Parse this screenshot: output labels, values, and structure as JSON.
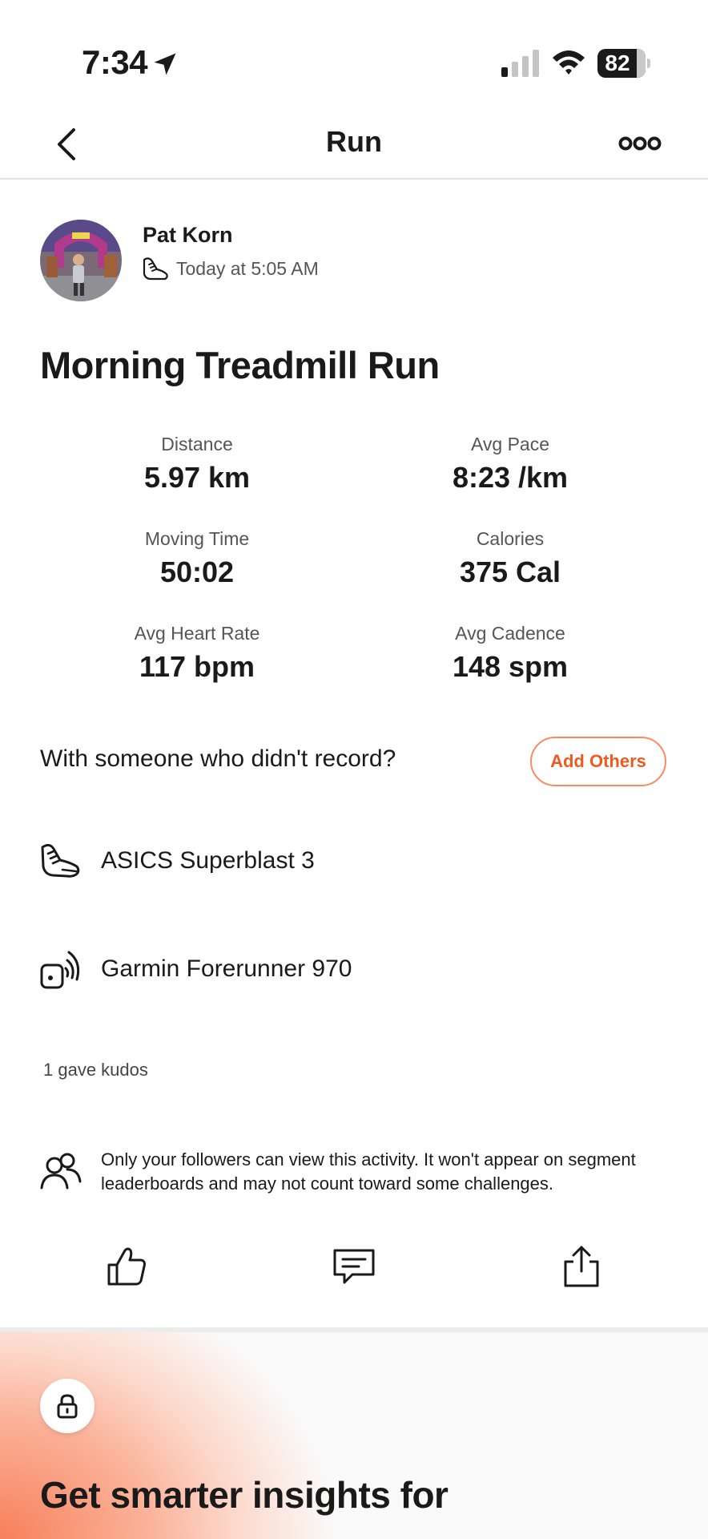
{
  "status_bar": {
    "time": "7:34",
    "battery": "82"
  },
  "nav": {
    "title": "Run"
  },
  "athlete": {
    "name": "Pat Korn",
    "time": "Today at 5:05 AM"
  },
  "activity": {
    "title": "Morning Treadmill Run"
  },
  "stats": [
    {
      "label": "Distance",
      "value": "5.97 km"
    },
    {
      "label": "Avg Pace",
      "value": "8:23 /km"
    },
    {
      "label": "Moving Time",
      "value": "50:02"
    },
    {
      "label": "Calories",
      "value": "375 Cal"
    },
    {
      "label": "Avg Heart Rate",
      "value": "117 bpm"
    },
    {
      "label": "Avg Cadence",
      "value": "148 spm"
    }
  ],
  "with_others": {
    "prompt": "With someone who didn't record?",
    "button": "Add Others"
  },
  "gear": [
    {
      "icon": "shoe-icon",
      "label": "ASICS Superblast 3"
    },
    {
      "icon": "device-icon",
      "label": "Garmin Forerunner 970"
    }
  ],
  "kudos": "1 gave kudos",
  "privacy": {
    "text": "Only your followers can view this activity. It won't appear on segment leaderboards and may not count toward some challenges."
  },
  "actions": [
    "kudos-icon",
    "comment-icon",
    "share-icon"
  ],
  "promo": {
    "title": "Get smarter insights for"
  },
  "colors": {
    "accent": "#ee5a1f",
    "accent_border": "#fc8a5f",
    "promo_gradient": "#f7805b"
  }
}
